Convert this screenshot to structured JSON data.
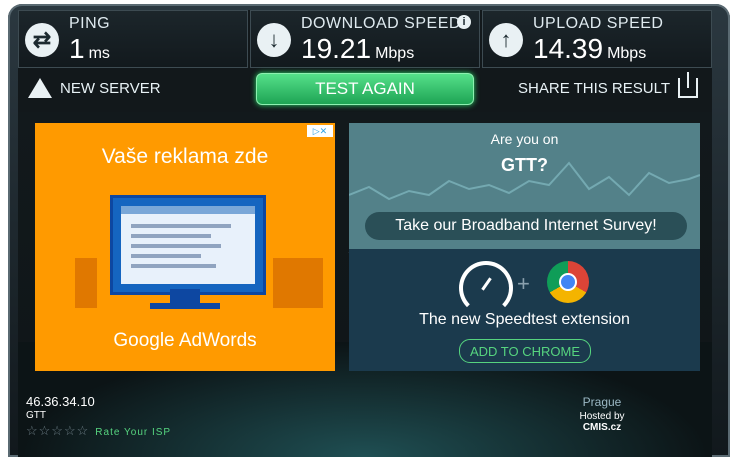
{
  "stats": {
    "ping": {
      "label": "PING",
      "value": "1",
      "unit": "ms"
    },
    "download": {
      "label": "DOWNLOAD SPEED",
      "value": "19.21",
      "unit": "Mbps"
    },
    "upload": {
      "label": "UPLOAD SPEED",
      "value": "14.39",
      "unit": "Mbps"
    }
  },
  "toolbar": {
    "new_server": "NEW SERVER",
    "test_again": "TEST AGAIN",
    "share": "SHARE THIS RESULT"
  },
  "ad": {
    "headline": "Vaše reklama zde",
    "brand": "Google AdWords"
  },
  "survey": {
    "question_line1": "Are you on",
    "question_line2": "GTT?",
    "cta": "Take our Broadband Internet Survey!"
  },
  "extension": {
    "tagline": "The new Speedtest extension",
    "button": "ADD TO CHROME"
  },
  "footer": {
    "ip": "46.36.34.10",
    "isp": "GTT",
    "rating": 0,
    "rate_label": "Rate Your ISP",
    "server_city": "Prague",
    "hosted_label": "Hosted by",
    "host": "CMIS.cz"
  },
  "icons": [
    "ping-icon",
    "download-icon",
    "upload-icon",
    "info-icon",
    "server-icon",
    "share-icon",
    "adchoices-icon",
    "speedometer-icon",
    "chrome-icon"
  ]
}
